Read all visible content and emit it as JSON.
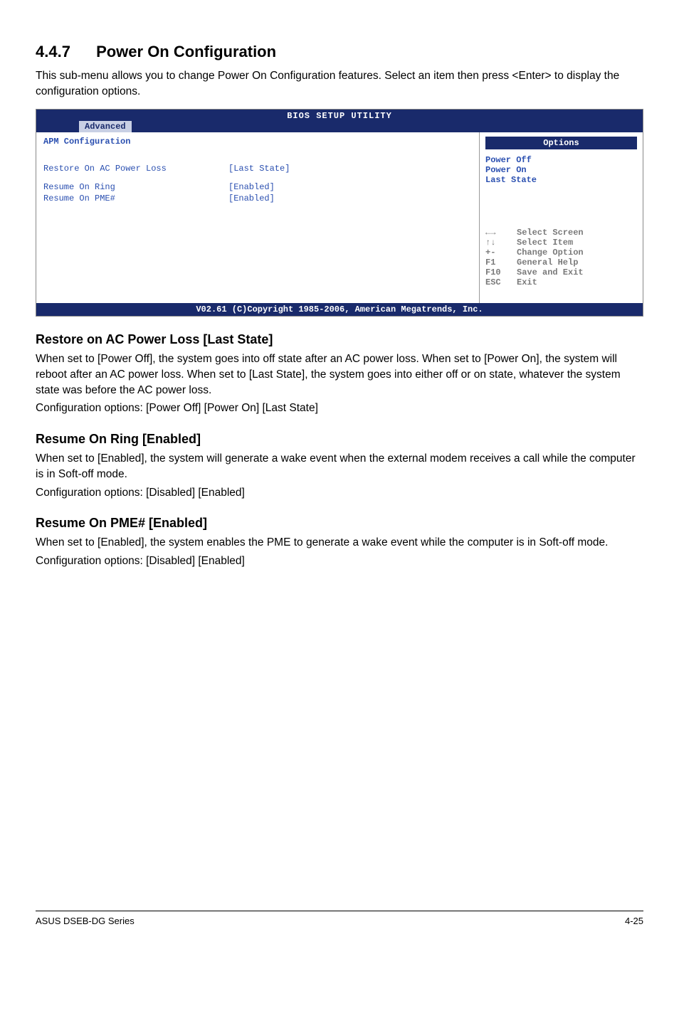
{
  "section": {
    "number": "4.4.7",
    "title": "Power On Configuration",
    "intro": "This sub-menu allows you to change Power On Configuration features. Select an item then press <Enter> to display the configuration options."
  },
  "bios": {
    "header_title": "BIOS SETUP UTILITY",
    "tab": "Advanced",
    "panel_title": "APM Configuration",
    "rows": [
      {
        "label": "Restore On AC Power Loss",
        "value": "[Last State]"
      },
      {
        "label": "Resume On Ring",
        "value": "[Enabled]"
      },
      {
        "label": "Resume On PME#",
        "value": "[Enabled]"
      }
    ],
    "options_title": "Options",
    "options": [
      "Power Off",
      "Power On",
      "Last State"
    ],
    "help": [
      {
        "key": "←→",
        "text": "Select Screen"
      },
      {
        "key": "↑↓",
        "text": "Select Item"
      },
      {
        "key": "+-",
        "text": "Change Option"
      },
      {
        "key": "F1",
        "text": "General Help"
      },
      {
        "key": "F10",
        "text": "Save and Exit"
      },
      {
        "key": "ESC",
        "text": "Exit"
      }
    ],
    "footer": "V02.61 (C)Copyright 1985-2006, American Megatrends, Inc."
  },
  "subsections": [
    {
      "title": "Restore on AC Power Loss [Last State]",
      "body": "When set to [Power Off], the system goes into off state after an AC power loss. When set to [Power On], the system will reboot after an AC power loss. When set to [Last State], the system goes into either off or on state, whatever the system state was before the AC power loss.",
      "config": "Configuration options: [Power Off] [Power On] [Last State]"
    },
    {
      "title": "Resume On Ring [Enabled]",
      "body": "When set to [Enabled], the system will generate a wake event when the external modem receives a call while the computer is in Soft-off mode.",
      "config": "Configuration options: [Disabled] [Enabled]"
    },
    {
      "title": "Resume On PME# [Enabled]",
      "body": "When set to [Enabled], the system enables the PME to generate a wake event while the computer is in Soft-off mode.",
      "config": "Configuration options: [Disabled] [Enabled]"
    }
  ],
  "footer": {
    "left": "ASUS DSEB-DG Series",
    "right": "4-25"
  }
}
